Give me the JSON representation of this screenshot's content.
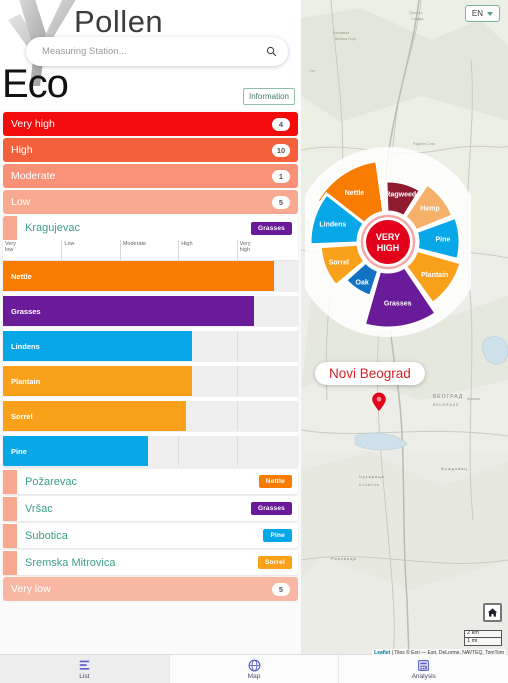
{
  "header": {
    "app_title": "Pollen",
    "logo_text": "Eco",
    "search_placeholder": "Measuring Station...",
    "search_value": "",
    "search_icon": "search-icon",
    "information_label": "Information"
  },
  "language": {
    "selected": "EN",
    "caret_icon": "chevron-down-icon"
  },
  "levels": [
    {
      "label": "Very high",
      "count": "4",
      "color": "#f20c0c"
    },
    {
      "label": "High",
      "count": "10",
      "color": "#f4603c"
    },
    {
      "label": "Moderate",
      "count": "1",
      "color": "#f99178"
    },
    {
      "label": "Low",
      "count": "5",
      "color": "#f9a98f"
    },
    {
      "label": "Very low",
      "count": "5",
      "color": "#f8b7a3"
    }
  ],
  "expanded_station": {
    "name": "Kragujevac",
    "swatch_color": "#f7a88f",
    "badge": {
      "label": "Grasses",
      "color": "#6a1b9a"
    }
  },
  "chart_data": {
    "type": "bar",
    "title": "Kragujevac",
    "orientation": "horizontal",
    "categories": [
      "Very low",
      "Low",
      "Moderate",
      "High",
      "Very high"
    ],
    "axis_labels": [
      "Very low",
      "Low",
      "Moderate",
      "High",
      "Very high"
    ],
    "xlabel": "",
    "ylabel": "",
    "xlim": [
      0,
      100
    ],
    "grid": true,
    "legend": "none",
    "series": [
      {
        "name": "Nettle",
        "value": 92,
        "color": "#f87c00"
      },
      {
        "name": "Grasses",
        "value": 85,
        "color": "#6a1b9a"
      },
      {
        "name": "Lindens",
        "value": 64,
        "color": "#08a8e8"
      },
      {
        "name": "Plantain",
        "value": 64,
        "color": "#f9a11b"
      },
      {
        "name": "Sorrel",
        "value": 62,
        "color": "#f9a11b"
      },
      {
        "name": "Pine",
        "value": 49,
        "color": "#08a8e8"
      }
    ]
  },
  "stations": [
    {
      "name": "Požarevac",
      "swatch_color": "#f7a88f",
      "badge": {
        "label": "Nettle",
        "color": "#f87c00"
      }
    },
    {
      "name": "Vršac",
      "swatch_color": "#f7a88f",
      "badge": {
        "label": "Grasses",
        "color": "#6a1b9a"
      }
    },
    {
      "name": "Subotica",
      "swatch_color": "#f7a88f",
      "badge": {
        "label": "Pine",
        "color": "#08a8e8"
      }
    },
    {
      "name": "Sremska Mitrovica",
      "swatch_color": "#f7a88f",
      "badge": {
        "label": "Sorrel",
        "color": "#f9a11b"
      }
    }
  ],
  "map": {
    "city_label": "Novi Beograd",
    "pin_icon": "map-pin-icon",
    "home_icon": "home-icon",
    "scale_metric": "2 km",
    "scale_imperial": "1 mi",
    "attribution_link": "Leaflet",
    "attribution_text": " | Tiles © Esri — Esri, DeLorme, NAVTEQ, TomTom",
    "wheel": {
      "center_line1": "VERY",
      "center_line2": "HIGH",
      "center_color": "#e2001a",
      "segments": [
        {
          "label": "Nettle",
          "color": "#f87c00",
          "start": -60,
          "sweep": 52,
          "outer": 82
        },
        {
          "label": "Ragweed",
          "color": "#8e1b2e",
          "start": -2,
          "sweep": 34,
          "outer": 61
        },
        {
          "label": "Hemp",
          "color": "#f5b06a",
          "start": 34,
          "sweep": 34,
          "outer": 70
        },
        {
          "label": "Pine",
          "color": "#08a8e8",
          "start": 70,
          "sweep": 34,
          "outer": 72
        },
        {
          "label": "Plantain",
          "color": "#f9a11b",
          "start": 106,
          "sweep": 38,
          "outer": 76
        },
        {
          "label": "Grasses",
          "color": "#6a1b9a",
          "start": 146,
          "sweep": 50,
          "outer": 86
        },
        {
          "label": "Oak",
          "color": "#1273c4",
          "start": 198,
          "sweep": 30,
          "outer": 57
        },
        {
          "label": "Sorrel",
          "color": "#f9a11b",
          "start": 230,
          "sweep": 36,
          "outer": 68
        },
        {
          "label": "Lindens",
          "color": "#08a8e8",
          "start": 268,
          "sweep": 40,
          "outer": 78
        }
      ]
    }
  },
  "bottom_nav": [
    {
      "label": "List",
      "icon": "list-icon",
      "active": true
    },
    {
      "label": "Map",
      "icon": "globe-icon",
      "active": false
    },
    {
      "label": "Analysis",
      "icon": "analysis-icon",
      "active": false
    }
  ]
}
